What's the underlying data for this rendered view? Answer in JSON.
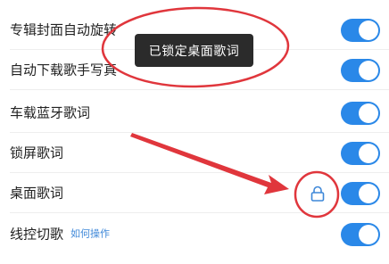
{
  "toast": {
    "text": "已锁定桌面歌词"
  },
  "settings": {
    "items": [
      {
        "label": "专辑封面自动旋转",
        "enabled": true
      },
      {
        "label": "自动下载歌手写真",
        "enabled": true
      },
      {
        "label": "车载蓝牙歌词",
        "enabled": true
      },
      {
        "label": "锁屏歌词",
        "enabled": true
      },
      {
        "label": "桌面歌词",
        "enabled": true,
        "icon": "lock-icon"
      },
      {
        "label": "线控切歌",
        "link": "如何操作",
        "enabled": true
      }
    ]
  },
  "colors": {
    "toggle_on": "#2a88e8",
    "annotation": "#e0363c",
    "link": "#3d87d8",
    "toast_bg": "#2b2b2b"
  }
}
